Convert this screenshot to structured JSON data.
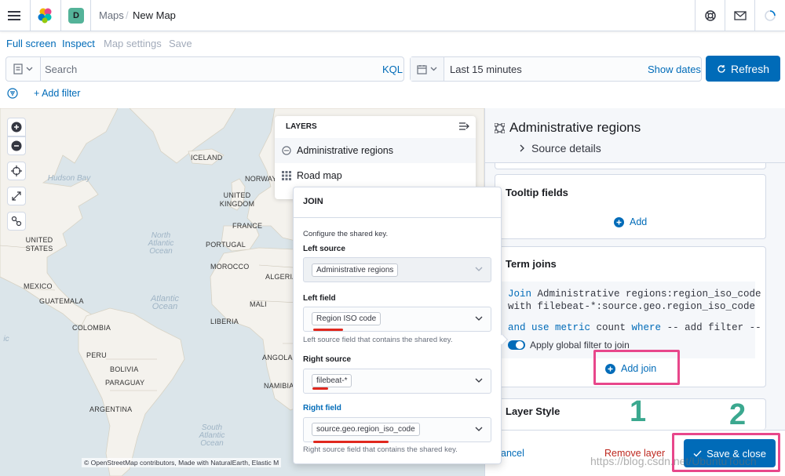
{
  "header": {
    "space_initial": "D",
    "breadcrumbs": [
      "Maps",
      "New Map"
    ],
    "separator": "/"
  },
  "top_menu": {
    "full_screen": "Full screen",
    "inspect": "Inspect",
    "map_settings": "Map settings",
    "save": "Save"
  },
  "query_bar": {
    "search_placeholder": "Search",
    "language": "KQL",
    "time_range": "Last 15 minutes",
    "show_dates": "Show dates",
    "refresh": "Refresh"
  },
  "filter_bar": {
    "add_filter": "+ Add filter"
  },
  "map": {
    "labels": [
      "ICELAND",
      "NORWAY",
      "UNITED KINGDOM",
      "FRANCE",
      "PORTUGAL",
      "MOROCCO",
      "ALGERIA",
      "MALI",
      "LIBERIA",
      "ANGOLA",
      "NAMIBIA",
      "UNITED STATES",
      "MEXICO",
      "GUATEMALA",
      "COLOMBIA",
      "PERU",
      "BOLIVIA",
      "PARAGUAY",
      "ARGENTINA"
    ],
    "oceans": [
      "Hudson Bay",
      "North Atlantic Ocean",
      "Atlantic Ocean",
      "South Atlantic Ocean",
      "ic"
    ],
    "attribution": "© OpenStreetMap contributors, Made with NaturalEarth, Elastic M"
  },
  "layers_panel": {
    "title": "LAYERS",
    "items": [
      {
        "label": "Administrative regions",
        "icon": "vector-circle-icon"
      },
      {
        "label": "Road map",
        "icon": "grid-icon"
      }
    ]
  },
  "join_popover": {
    "title": "JOIN",
    "description": "Configure the shared key.",
    "left_source_label": "Left source",
    "left_source_value": "Administrative regions",
    "left_field_label": "Left field",
    "left_field_value": "Region ISO code",
    "left_field_help": "Left source field that contains the shared key.",
    "right_source_label": "Right source",
    "right_source_value": "filebeat-*",
    "right_field_label": "Right field",
    "right_field_value": "source.geo.region_iso_code",
    "right_field_help": "Right source field that contains the shared key."
  },
  "right_panel": {
    "title": "Administrative regions",
    "source_details": "Source details",
    "tooltip_fields_title": "Tooltip fields",
    "tooltip_add": "Add",
    "term_joins_title": "Term joins",
    "join_line1": {
      "kw": "Join",
      "text": " Administrative regions:region_iso_code"
    },
    "join_line2": "with filebeat-*:source.geo.region_iso_code",
    "join_line3": {
      "kw1": "and use metric",
      "text1": " count ",
      "kw2": "where",
      "text2": " -- add filter --"
    },
    "apply_global_filter": "Apply global filter to join",
    "add_join": "Add join",
    "layer_style_title": "Layer Style",
    "cancel": "ancel",
    "remove_layer": "Remove layer",
    "save_close": "Save & close"
  },
  "annotations": {
    "step1": "1",
    "step2": "2"
  },
  "watermark": "https://blog.csdn.net/UbuntuTouch",
  "colors": {
    "primary": "#006bb8",
    "highlight": "#e8478b",
    "annotation_green": "#3ba88f",
    "danger": "#bd271e"
  }
}
